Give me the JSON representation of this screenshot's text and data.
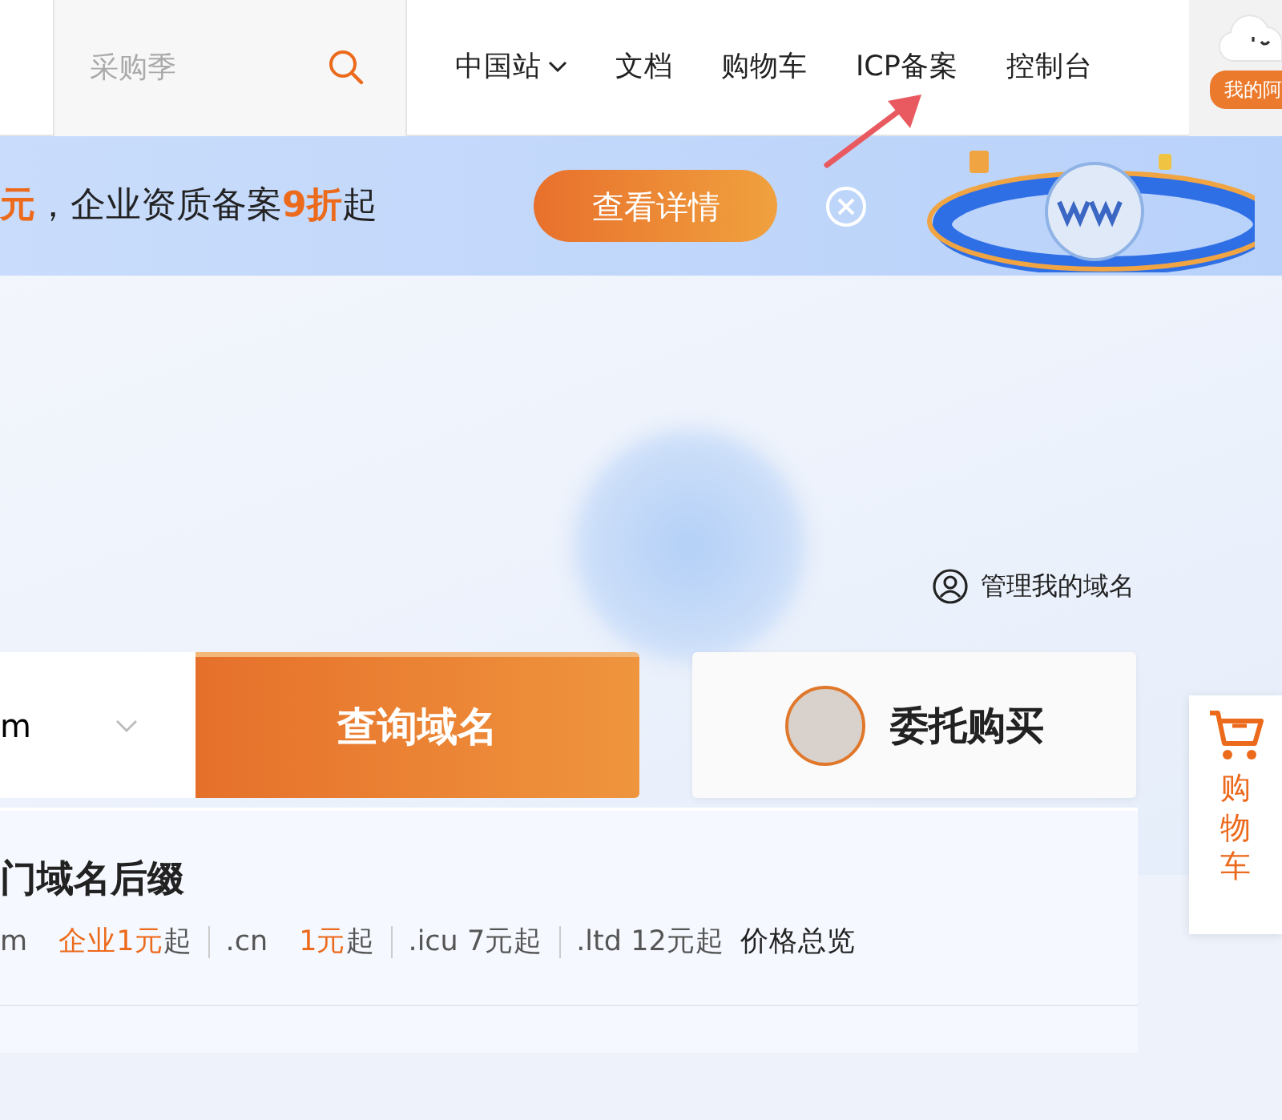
{
  "header": {
    "search": {
      "placeholder": "采购季"
    },
    "nav": [
      {
        "label": "中国站",
        "dropdown": true
      },
      {
        "label": "文档",
        "dropdown": false
      },
      {
        "label": "购物车",
        "dropdown": false
      },
      {
        "label": "ICP备案",
        "dropdown": false
      },
      {
        "label": "控制台",
        "dropdown": false
      }
    ],
    "user_badge": "我的阿"
  },
  "banner": {
    "segments": [
      {
        "text": "元",
        "highlight": true
      },
      {
        "text": "，企业资质备案",
        "highlight": false
      },
      {
        "text": "9折",
        "highlight": true
      },
      {
        "text": "起",
        "highlight": false
      }
    ],
    "button": "查看详情"
  },
  "hero": {
    "manage_link": "管理我的域名",
    "domain_field": {
      "value": "m"
    },
    "search_button": "查询域名",
    "entrust_button": "委托购买"
  },
  "cart_tab": {
    "label": "购物车"
  },
  "suffix_panel": {
    "title": "门域名后缀",
    "items": [
      {
        "suffix": "m",
        "highlight": "企业1元",
        "price": "起"
      },
      {
        "suffix": ".cn",
        "highlight": "1元",
        "price": "起"
      },
      {
        "suffix": ".icu",
        "price": "7元起"
      },
      {
        "suffix": ".ltd",
        "price": "12元起"
      }
    ],
    "overview_link": "价格总览"
  }
}
